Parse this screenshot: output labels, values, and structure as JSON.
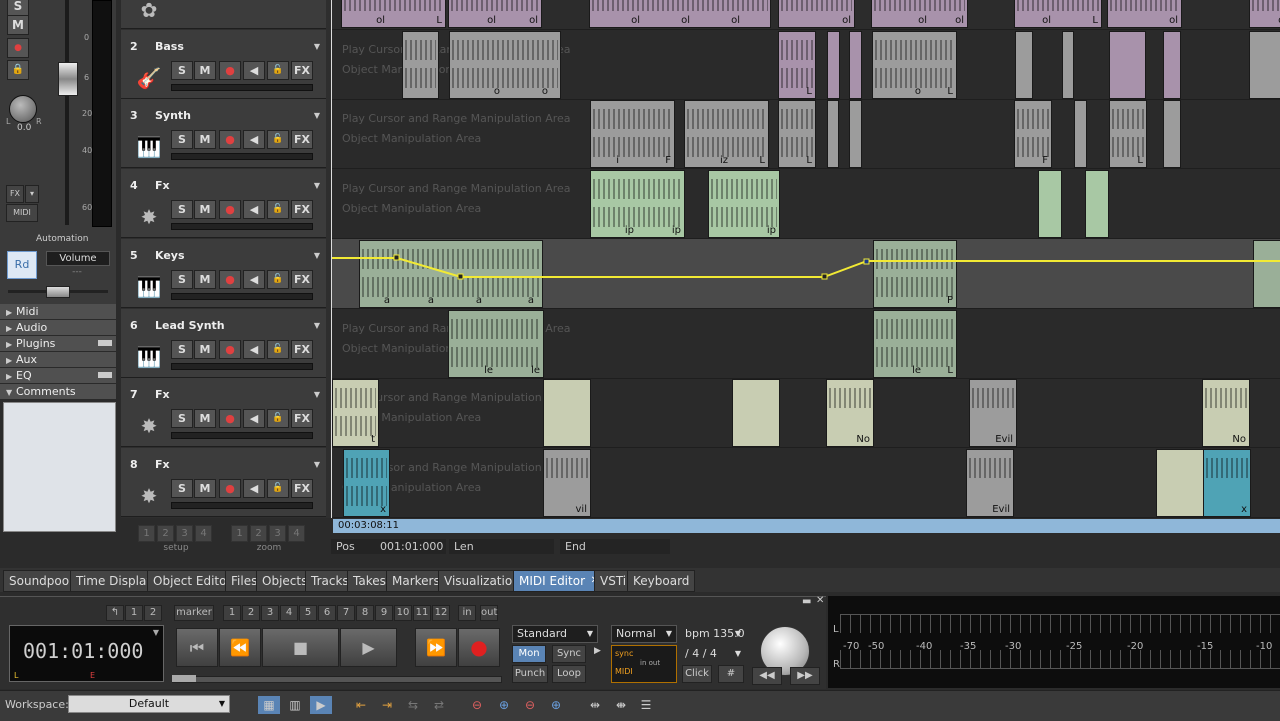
{
  "mixer": {
    "buttons": [
      "S",
      "M"
    ],
    "pan_value": "0.0",
    "pan_l": "L",
    "pan_r": "R",
    "fader_scale": [
      "0",
      "6",
      "20",
      "40",
      "60"
    ],
    "fx_label": "FX",
    "midi_label": "MIDI",
    "automation_label": "Automation",
    "rd_label": "Rd",
    "volume_label": "Volume",
    "volume_value": "---"
  },
  "sections": [
    {
      "label": "Midi",
      "expanded": false
    },
    {
      "label": "Audio",
      "expanded": false
    },
    {
      "label": "Plugins",
      "expanded": false
    },
    {
      "label": "Aux",
      "expanded": false
    },
    {
      "label": "EQ",
      "expanded": false
    },
    {
      "label": "Comments",
      "expanded": true
    }
  ],
  "tracks": [
    {
      "num": "2",
      "name": "Bass",
      "icon": "guitar-icon"
    },
    {
      "num": "3",
      "name": "Synth",
      "icon": "keyboard-icon"
    },
    {
      "num": "4",
      "name": "Fx",
      "icon": "fx-star-icon"
    },
    {
      "num": "5",
      "name": "Keys",
      "icon": "piano-icon"
    },
    {
      "num": "6",
      "name": "Lead Synth",
      "icon": "keyboard-icon"
    },
    {
      "num": "7",
      "name": "Fx",
      "icon": "fx-star-icon"
    },
    {
      "num": "8",
      "name": "Fx",
      "icon": "fx-star-icon"
    }
  ],
  "track_controls": [
    "S",
    "M",
    "●",
    "◀",
    "🔓",
    "FX"
  ],
  "lane_hints": {
    "line1": "Play Cursor and Range Manipulation Area",
    "line2": "Object Manipulation Area"
  },
  "clip_labels": {
    "top": [
      "ol",
      "L",
      "ol",
      "ol",
      "ol",
      "ol",
      "ol",
      "ol",
      "L",
      "ol",
      "ol",
      "ol",
      "ol",
      "L",
      "ol",
      "ol"
    ],
    "bass": [
      "o",
      "o",
      "L",
      "o",
      "L"
    ],
    "synth": [
      "i",
      "F",
      "iz",
      "L",
      "L",
      "F",
      "L"
    ],
    "fx4": [
      "ip",
      "ip",
      "ip"
    ],
    "keys": [
      "a",
      "a",
      "a",
      "a",
      "P"
    ],
    "lead": [
      "le",
      "le",
      "le",
      "L"
    ],
    "fx7": [
      "t",
      "No",
      "Evil",
      "No"
    ],
    "fx8": [
      "x",
      "vil",
      "Evil",
      "x"
    ]
  },
  "setup_zoom": {
    "setup_label": "setup",
    "zoom_label": "zoom",
    "setup_buttons": [
      "1",
      "2",
      "3",
      "4"
    ],
    "zoom_buttons": [
      "1",
      "2",
      "3",
      "4"
    ]
  },
  "timeline": {
    "position": "00:03:08:11"
  },
  "posbar": {
    "pos_label": "Pos",
    "pos_value": "001:01:000",
    "len_label": "Len",
    "end_label": "End"
  },
  "tabs": [
    {
      "label": "Soundpool",
      "active": false
    },
    {
      "label": "Time Display",
      "active": false
    },
    {
      "label": "Object Editor",
      "active": false
    },
    {
      "label": "Files",
      "active": false
    },
    {
      "label": "Objects",
      "active": false
    },
    {
      "label": "Tracks",
      "active": false
    },
    {
      "label": "Takes",
      "active": false
    },
    {
      "label": "Markers",
      "active": false
    },
    {
      "label": "Visualization",
      "active": false
    },
    {
      "label": "MIDI Editor",
      "active": true
    },
    {
      "label": "VSTi",
      "active": false
    },
    {
      "label": "Keyboard",
      "active": false
    }
  ],
  "transport": {
    "time": "001:01:000",
    "time_l": "L",
    "time_e": "E",
    "marker_label": "marker",
    "marker_nums": [
      "1",
      "2",
      "3",
      "4",
      "5",
      "6",
      "7",
      "8",
      "9",
      "10",
      "11",
      "12"
    ],
    "in_label": "in",
    "out_label": "out",
    "undo_nums": [
      "1",
      "2"
    ],
    "mode": "Standard",
    "mon": "Mon",
    "sync": "Sync",
    "punch": "Punch",
    "loop": "Loop",
    "play_mode": "Normal",
    "bpm": "bpm 135.0",
    "signature": "4 / 4",
    "signature_slash": "/",
    "click": "Click",
    "sync_label": "sync",
    "midi_label": "MIDI",
    "in_out": "in out"
  },
  "level_meter": {
    "scale": [
      "-70",
      "-50",
      "-40",
      "-35",
      "-30",
      "-25",
      "-20",
      "-15",
      "-10"
    ],
    "l": "L",
    "r": "R"
  },
  "workspace": {
    "label": "Workspace:",
    "value": "Default"
  }
}
